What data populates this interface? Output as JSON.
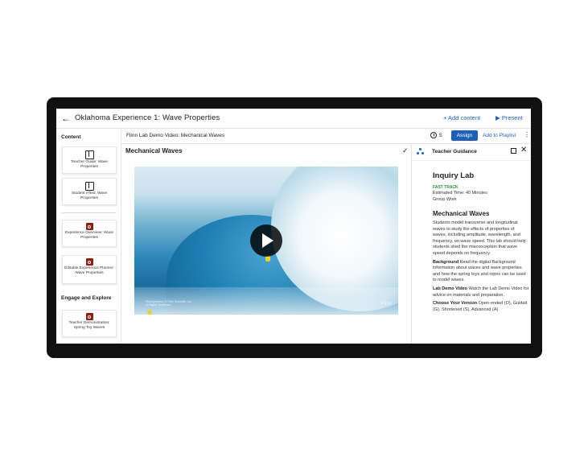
{
  "header": {
    "title": "Oklahoma Experience 1: Wave Properties",
    "add_content": "+ Add content",
    "present": "▶ Present"
  },
  "sidebar": {
    "section_content": "Content",
    "section_engage": "Engage and Explore",
    "cards": [
      {
        "label": "Teacher Guide: Wave Properties",
        "icon": "book-icon"
      },
      {
        "label": "Student eText: Wave Properties",
        "icon": "book-icon"
      },
      {
        "label": "Experience Overview: Wave Properties",
        "icon": "flinn-logo-icon"
      },
      {
        "label": "Editable Experience Planner: Wave Properties",
        "icon": "flinn-logo-icon"
      },
      {
        "label": "Teacher Demonstration: Spring Toy Waves",
        "icon": "flinn-logo-icon"
      }
    ]
  },
  "subbar": {
    "item_title": "Flinn Lab Demo Video: Mechanical Waves",
    "time_value": "5",
    "assign_label": "Assign",
    "playlist_label": "Add to Playlist"
  },
  "main": {
    "title": "Mechanical Waves",
    "video": {
      "brand": "Flinn",
      "caption": "Photographer | © Flinn Scientific, Inc. All Rights Reserved."
    }
  },
  "guidance": {
    "header": "Teacher Guidance",
    "heading": "Inquiry Lab",
    "fast_track": "FAST TRACK",
    "estimated_time": "Estimated Time: 40 Minutes",
    "group_work": "Group Work",
    "section_title": "Mechanical Waves",
    "intro": "Students model transverse and longitudinal waves to study the effects of properties of waves, including amplitude, wavelength, and frequency, on wave speed. This lab should help students shed the misconception that wave speed depends on frequency.",
    "background_label": "Background",
    "background_text": " Read the digital Background information about waves and wave properties and how the spring toys and ropes can be used to model waves.",
    "lab_demo_label": "Lab Demo Video",
    "lab_demo_text": " Watch the Lab Demo Video for advice on materials and preparation.",
    "version_label": "Choose Your Version",
    "version_text": " Open-ended (O), Guided (G), Shortened (S), Advanced (A)"
  },
  "colors": {
    "accent": "#1f5fb8",
    "fast_track": "#2e8b3a",
    "flinn_red": "#8c1e17",
    "device_frame": "#111111"
  }
}
